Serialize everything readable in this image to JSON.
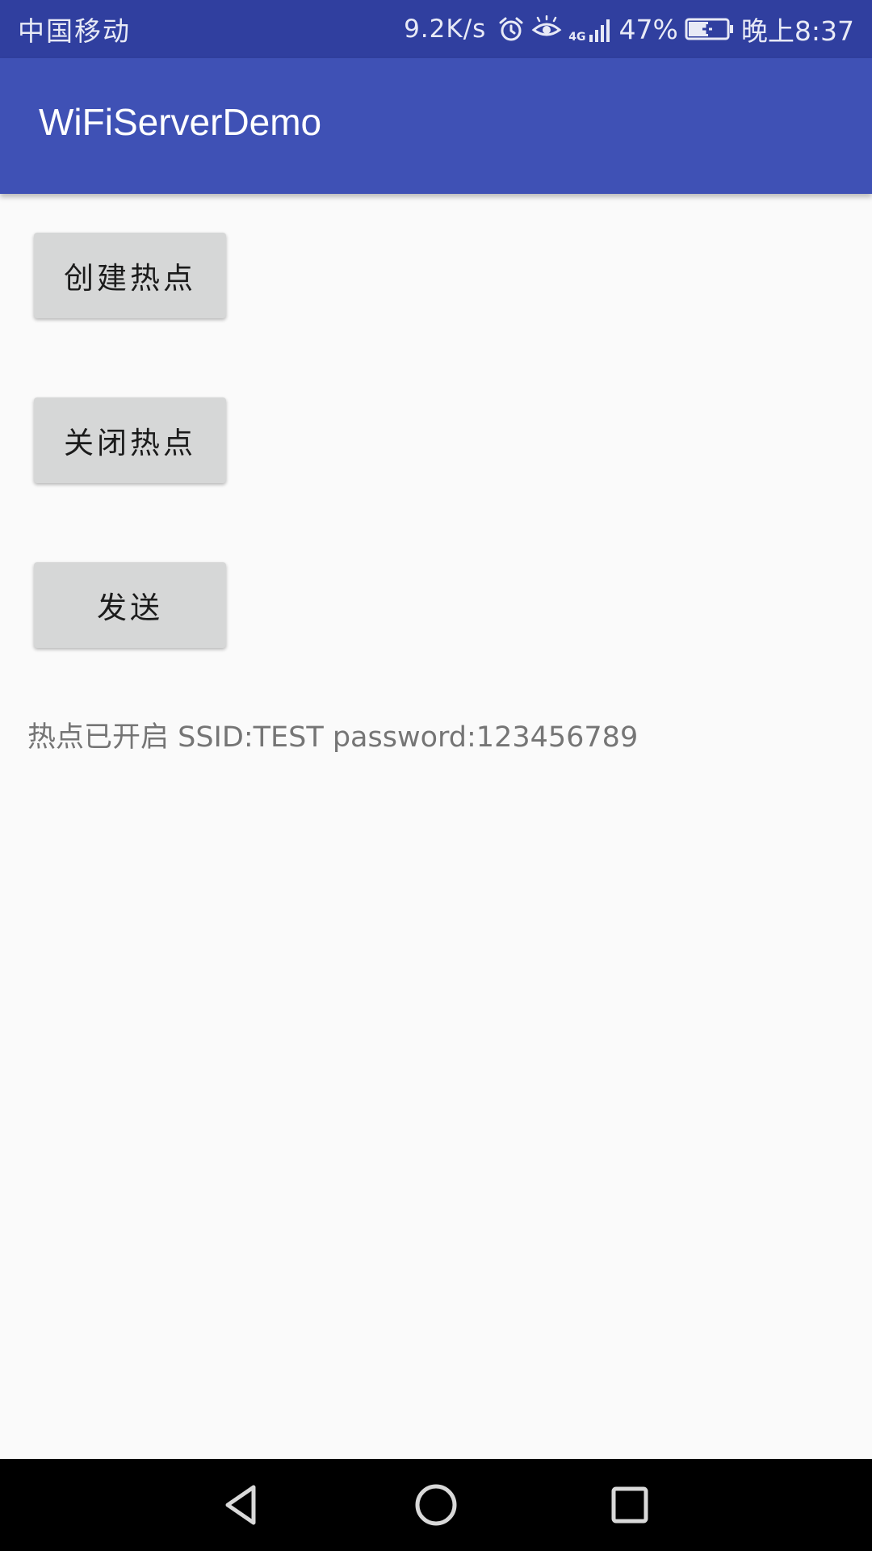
{
  "status_bar": {
    "carrier": "中国移动",
    "net_speed": "9.2K/s",
    "network_type": "4G",
    "battery_percent": "47%",
    "time": "晚上8:37",
    "icons": [
      "alarm-icon",
      "eye-comfort-icon",
      "signal-icon",
      "battery-charging-icon"
    ]
  },
  "app_bar": {
    "title": "WiFiServerDemo"
  },
  "buttons": {
    "create_hotspot": "创建热点",
    "close_hotspot": "关闭热点",
    "send": "发送"
  },
  "status_message": "热点已开启 SSID:TEST password:123456789",
  "nav_bar": {
    "icons": [
      "back-icon",
      "home-icon",
      "recents-icon"
    ]
  },
  "colors": {
    "status_bar": "#303F9F",
    "app_bar": "#3F51B5",
    "background": "#FAFAFA",
    "button": "#D6D7D7",
    "status_text": "#757575",
    "nav_bar": "#000000"
  }
}
